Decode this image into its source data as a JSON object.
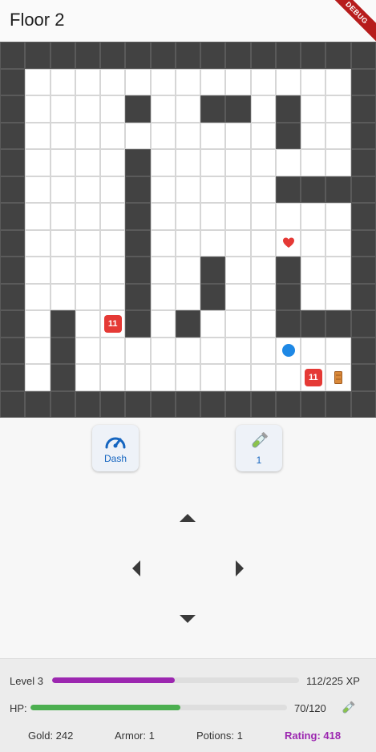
{
  "appbar": {
    "title": "Floor 2",
    "debug_banner": "DEBUG"
  },
  "map": {
    "rows": [
      "###############",
      "#.............#",
      "#....#..##.#..#",
      "#..........#..#",
      "#....#........#",
      "#....#.....####",
      "#....#........#",
      "#....#.....H..#",
      "#....#..#..#..#",
      "#....#..#..#..#",
      "#.#.E#.#...####",
      "#.#........P..#",
      "#.#.........ED#",
      "###############"
    ],
    "legend": {
      "#": "wall",
      ".": "floor",
      "E": "enemy",
      "H": "heart-pickup",
      "P": "player",
      "D": "door"
    },
    "enemy_labels": [
      "11",
      "11"
    ],
    "colors": {
      "wall": "#424242",
      "floor": "#ffffff",
      "enemy": "#e53935",
      "player": "#1e88e5"
    }
  },
  "actions": {
    "dash": {
      "label": "Dash",
      "icon": "speedometer-icon"
    },
    "potion": {
      "count": "1",
      "icon": "potion-icon"
    }
  },
  "dpad": {
    "up": "up-arrow-icon",
    "down": "down-arrow-icon",
    "left": "left-arrow-icon",
    "right": "right-arrow-icon"
  },
  "stats": {
    "level_label": "Level 3",
    "xp_text": "112/225 XP",
    "xp_fraction": 0.498,
    "hp_label": "HP:",
    "hp_text": "70/120",
    "hp_fraction": 0.583,
    "gold": "Gold: 242",
    "armor": "Armor: 1",
    "potions": "Potions: 1",
    "rating": "Rating: 418",
    "colors": {
      "xp": "#9c27b0",
      "hp": "#4caf50",
      "rating": "#9c27b0"
    }
  }
}
